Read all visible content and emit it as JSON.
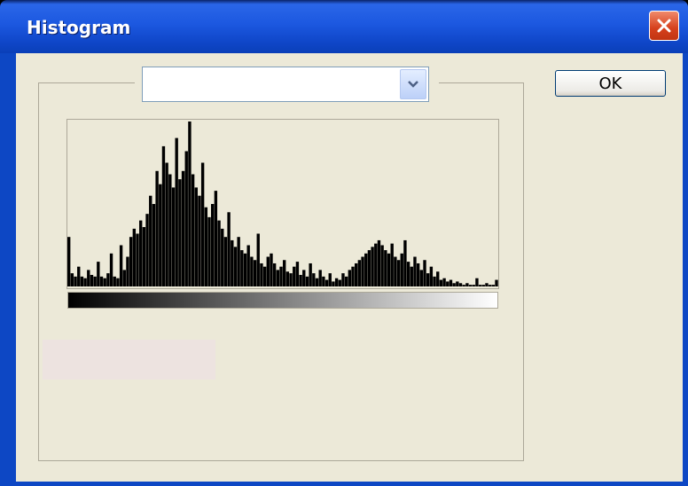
{
  "window": {
    "title": "Histogram"
  },
  "controls": {
    "channel_select_value": "",
    "ok_label": "OK"
  },
  "chart_data": {
    "type": "bar",
    "title": "",
    "xlabel": "",
    "ylabel": "",
    "x_range": [
      0,
      255
    ],
    "ylim": [
      0,
      100
    ],
    "values": [
      30,
      8,
      6,
      12,
      6,
      5,
      10,
      7,
      6,
      15,
      6,
      5,
      8,
      20,
      6,
      5,
      25,
      10,
      18,
      30,
      35,
      32,
      40,
      36,
      44,
      55,
      50,
      70,
      62,
      85,
      75,
      68,
      60,
      90,
      65,
      70,
      82,
      100,
      68,
      60,
      55,
      75,
      48,
      42,
      50,
      58,
      40,
      35,
      30,
      45,
      28,
      24,
      30,
      22,
      20,
      25,
      18,
      16,
      32,
      14,
      12,
      18,
      20,
      14,
      10,
      12,
      16,
      9,
      8,
      12,
      15,
      7,
      10,
      6,
      14,
      8,
      5,
      10,
      6,
      4,
      8,
      3,
      5,
      4,
      8,
      6,
      10,
      12,
      14,
      16,
      18,
      20,
      22,
      24,
      26,
      28,
      25,
      22,
      20,
      26,
      18,
      16,
      20,
      28,
      15,
      12,
      18,
      14,
      10,
      16,
      8,
      12,
      6,
      9,
      4,
      5,
      3,
      4,
      2,
      3,
      2,
      1,
      2,
      1,
      1,
      5,
      1,
      1,
      2,
      1,
      1,
      4
    ],
    "bar_color": "#000000",
    "gradient_bar": {
      "from": "#000000",
      "to": "#ffffff"
    }
  },
  "colors": {
    "titlebar": "#2a66e8",
    "client_bg": "#ece9d8",
    "close_button": "#d6401c",
    "info_panel": "#ede3e0"
  },
  "icons": {
    "close": "close-icon",
    "dropdown": "chevron-down-icon"
  }
}
